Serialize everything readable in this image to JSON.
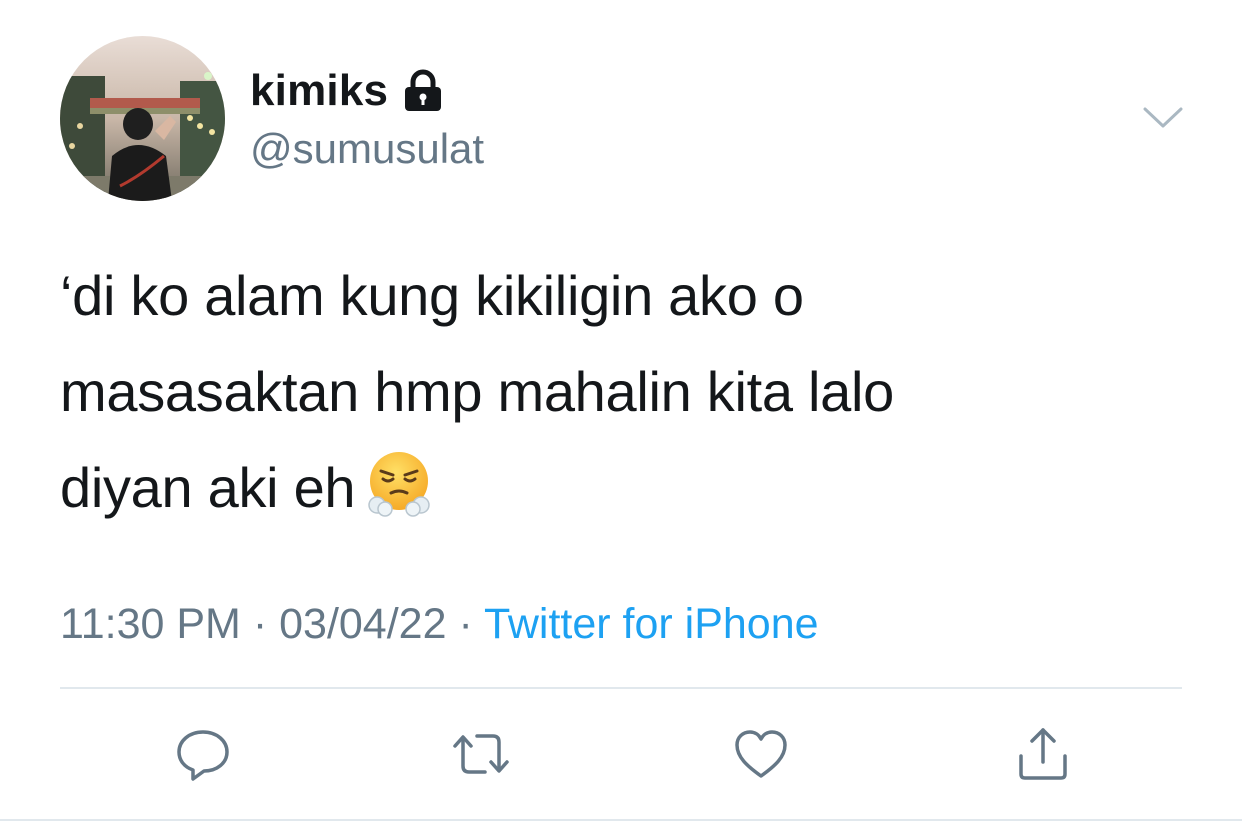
{
  "user": {
    "display_name": "kimiks",
    "handle": "@sumusulat",
    "protected": true,
    "avatar_icon": "avatar-photo"
  },
  "tweet": {
    "lines": [
      "‘di ko alam kung kikiligin ako o",
      "masasaktan hmp mahalin kita lalo",
      "diyan aki eh"
    ],
    "emoji": "face-with-steam-from-nose"
  },
  "meta": {
    "time": "11:30 PM",
    "separator": "·",
    "date": "03/04/22",
    "source": "Twitter for iPhone"
  },
  "actions": [
    {
      "icon": "reply-icon"
    },
    {
      "icon": "retweet-icon"
    },
    {
      "icon": "like-icon"
    },
    {
      "icon": "share-icon"
    }
  ],
  "colors": {
    "text": "#14171a",
    "secondary": "#657786",
    "link": "#1da1f2",
    "divider": "#e1e8ed"
  }
}
